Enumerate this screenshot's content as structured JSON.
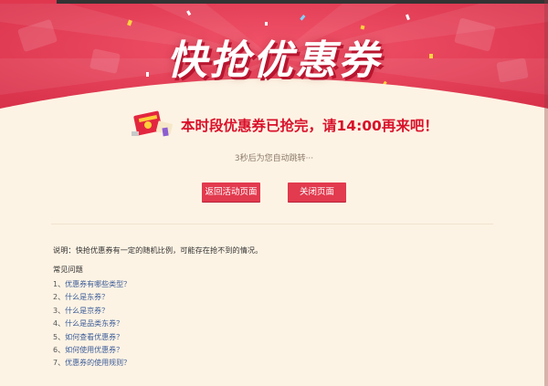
{
  "banner": {
    "title": "快抢优惠券",
    "colors": {
      "red": "#e9435a",
      "dark_red": "#d42c45",
      "cream": "#fdf3e4"
    }
  },
  "notice": {
    "icon": "red-envelope-gift-icon",
    "message": "本时段优惠券已抢完，请14:00再来吧！",
    "redirect_text": "3秒后为您自动跳转···"
  },
  "buttons": {
    "back_label": "返回活动页面",
    "close_label": "关闭页面"
  },
  "info": {
    "note": "说明：快抢优惠券有一定的随机比例，可能存在抢不到的情况。",
    "faq_title": "常见问题",
    "faq_items": [
      {
        "num": "1、",
        "text": "优惠券有哪些类型？"
      },
      {
        "num": "2、",
        "text": "什么是东券？"
      },
      {
        "num": "3、",
        "text": "什么是京券？"
      },
      {
        "num": "4、",
        "text": "什么是品类东券？"
      },
      {
        "num": "5、",
        "text": "如何查看优惠券？"
      },
      {
        "num": "6、",
        "text": "如何使用优惠券？"
      },
      {
        "num": "7、",
        "text": "优惠券的使用规则？"
      }
    ]
  }
}
